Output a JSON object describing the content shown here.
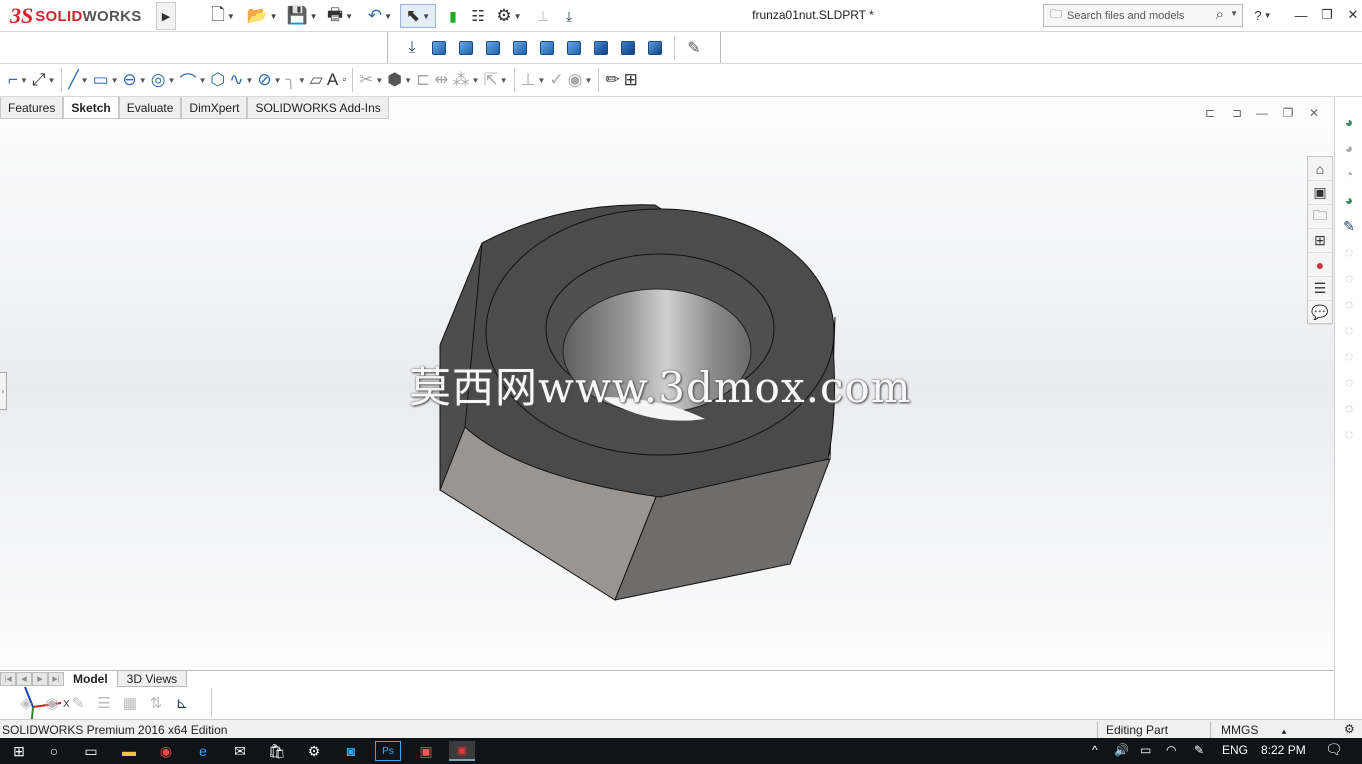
{
  "app": {
    "brand_ds": "3S",
    "brand_solid": "SOLID",
    "brand_works": "WORKS",
    "document_title": "frunza01nut.SLDPRT *"
  },
  "search": {
    "placeholder": "Search files and models"
  },
  "window": {
    "help": "?",
    "minimize": "—",
    "restore": "❐",
    "close": "✕"
  },
  "tabs": [
    "Features",
    "Sketch",
    "Evaluate",
    "DimXpert",
    "SOLIDWORKS Add-Ins"
  ],
  "active_tab": "Sketch",
  "graphics": {
    "watermark": "莫西网www.3dmox.com"
  },
  "triad": {
    "x": "X",
    "y": "Y",
    "z": "Z"
  },
  "bottom_tabs": [
    "Model",
    "3D Views"
  ],
  "status": {
    "edition": "SOLIDWORKS Premium 2016 x64 Edition",
    "mode": "Editing Part",
    "units": "MMGS",
    "units_arrow": "▴"
  },
  "taskbar": {
    "language": "ENG",
    "time": "8:22 PM"
  },
  "colors": {
    "brand_red": "#d2232a",
    "accent_blue": "#2b6cb0",
    "taskbar": "#101418",
    "model_grey": "#4a4a4a"
  },
  "icons": {
    "view_cubes": [
      "isometric",
      "front",
      "back",
      "left",
      "right",
      "top",
      "bottom",
      "trimetric",
      "dimetric"
    ]
  }
}
